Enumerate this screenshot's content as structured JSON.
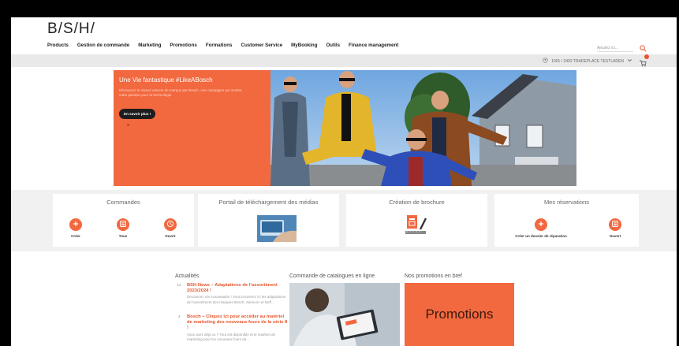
{
  "header": {
    "logo": "B/S/H/",
    "nav": [
      "Products",
      "Gestion de commande",
      "Marketing",
      "Promotions",
      "Formations",
      "Customer Service",
      "MyBooking",
      "Outils",
      "Finance management"
    ],
    "search_placeholder": "Ajoutez ici...",
    "account": "1001 / 2402 TRADEPLACE TESTLADEN"
  },
  "hero": {
    "title": "Une Vie fantastique #LikeABosch",
    "description": "Découvrez le nouvel univers de marque par Bosch, une campagne qui montre notre passion pour la technologie.",
    "button": "En savoir plus !"
  },
  "tiles": {
    "commandes": {
      "title": "Commandes",
      "actions": [
        "Créer",
        "Tous",
        "Ouvrir"
      ]
    },
    "portail": {
      "title": "Portail de téléchargement des médias"
    },
    "brochure": {
      "title": "Création de brochure"
    },
    "reservations": {
      "title": "Mes réservations",
      "actions": [
        "Créer un dossier de réparation",
        "Ouvert"
      ]
    }
  },
  "actualites": {
    "title": "Actualités",
    "items": [
      {
        "date": "12",
        "title": "BSH News – Adaptations de l’assortiment 2023/2024 !",
        "text": "Découvrez vos nouveautés ! Vous trouverez ici les adaptations de l’assortiment des marques Bosch, Siemens et Neff..."
      },
      {
        "date": "4",
        "title": "Bosch – Cliquez ici pour accéder au matériel de marketing des nouveaux fours de la série 8 !",
        "text": "Vous avez déjà vu ? Tout est disponible et le matériel de marketing pour les nouveaux fours de..."
      }
    ]
  },
  "catalogue": {
    "title": "Commande de catalogues en ligne"
  },
  "promotions": {
    "title": "Nos promotions en bref",
    "label": "Promotions"
  },
  "colors": {
    "accent": "#f2683f",
    "band": "#f1f1f1",
    "subbar": "#e9e9e9"
  }
}
